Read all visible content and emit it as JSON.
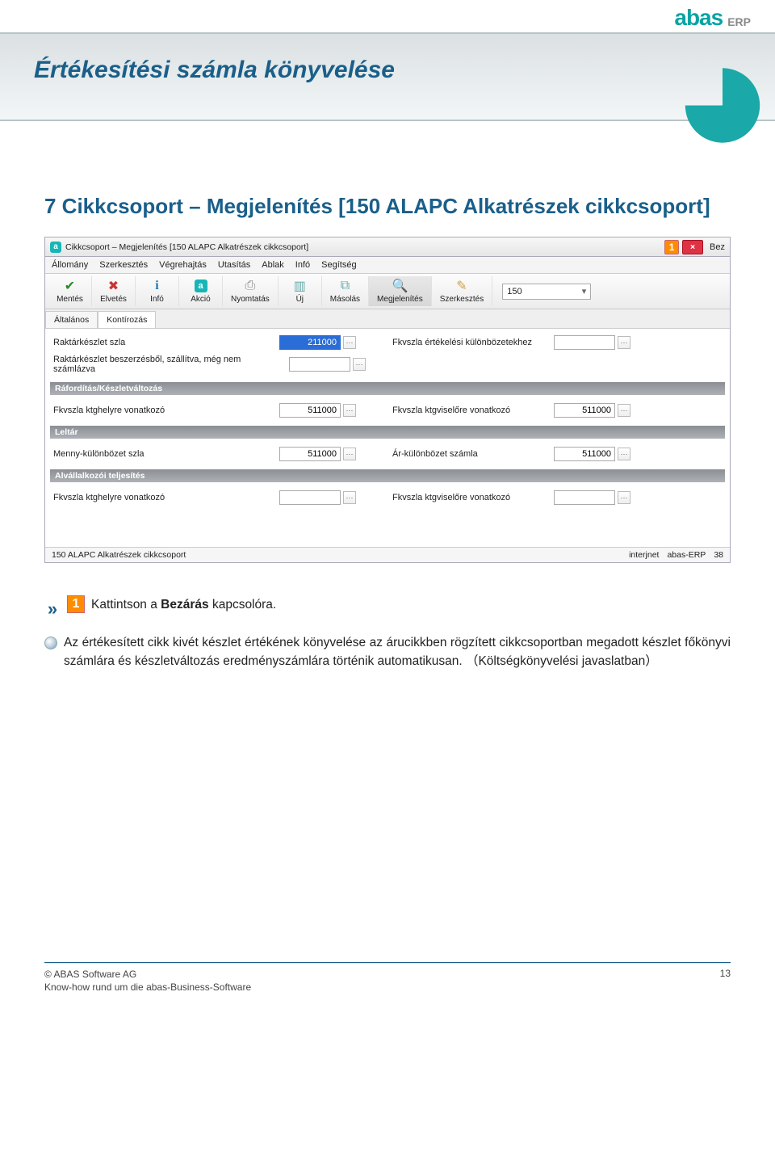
{
  "brand": {
    "logo": "abas",
    "sub": "ERP"
  },
  "header": {
    "title": "Értékesítési számla könyvelése"
  },
  "section": {
    "heading": "7 Cikkcsoport – Megjelenítés [150   ALAPC   Alkatrészek cikkcsoport]"
  },
  "window": {
    "title": "Cikkcsoport – Megjelenítés [150   ALAPC   Alkatrészek cikkcsoport]",
    "pin": "1",
    "close": "×",
    "bez_label": "Bez",
    "menu": [
      "Állomány",
      "Szerkesztés",
      "Végrehajtás",
      "Utasítás",
      "Ablak",
      "Infó",
      "Segítség"
    ],
    "toolbar": [
      {
        "name": "mentes",
        "icon": "✔",
        "label": "Mentés",
        "color": "#2a8a2a"
      },
      {
        "name": "elvetes",
        "icon": "✖",
        "label": "Elvetés",
        "color": "#c33"
      },
      {
        "name": "info",
        "icon": "i",
        "label": "Infó",
        "color": "#27a"
      },
      {
        "name": "akcio",
        "icon": "a",
        "label": "Akció",
        "color": "#16b6b6"
      },
      {
        "name": "nyomtatas",
        "icon": "⎙",
        "label": "Nyomtatás",
        "color": "#888"
      },
      {
        "name": "uj",
        "icon": "▥",
        "label": "Új",
        "color": "#6aa"
      },
      {
        "name": "masolas",
        "icon": "⧉",
        "label": "Másolás",
        "color": "#6aa"
      },
      {
        "name": "megjelenites",
        "icon": "🔍",
        "label": "Megjelenítés",
        "color": "#777"
      },
      {
        "name": "szerkesztes",
        "icon": "✎",
        "label": "Szerkesztés",
        "color": "#cca24a"
      }
    ],
    "search_value": "150",
    "tabs": [
      "Általános",
      "Kontírozás"
    ],
    "active_tab": 1,
    "fields": {
      "raktarkeszlet_szla": {
        "label": "Raktárkészlet szla",
        "value": "211000",
        "highlighted": true
      },
      "raktar_beszerzes": {
        "label": "Raktárkészlet beszerzésből, szállítva, még nem számlázva",
        "value": ""
      },
      "fkv_ertek_kulonb": {
        "label": "Fkvszla értékelési különbözetekhez",
        "value": ""
      },
      "sec1": "Ráfordítás/Készletváltozás",
      "fkv_ktghely": {
        "label": "Fkvszla ktghelyre vonatkozó",
        "value": "511000"
      },
      "fkv_ktgviselo": {
        "label": "Fkvszla ktgviselőre vonatkozó",
        "value": "511000"
      },
      "sec2": "Leltár",
      "menny_kulonb": {
        "label": "Menny-különbözet szla",
        "value": "511000"
      },
      "ar_kulonb": {
        "label": "Ár-különbözet számla",
        "value": "511000"
      },
      "sec3": "Alvállalkozói teljesítés",
      "alv_ktghely": {
        "label": "Fkvszla ktghelyre vonatkozó",
        "value": ""
      },
      "alv_ktgviselo": {
        "label": "Fkvszla ktgviselőre vonatkozó",
        "value": ""
      }
    },
    "status_left": "150 ALAPC     Alkatrészek cikkcsoport",
    "status_right": [
      "interjnet",
      "abas-ERP",
      "38"
    ]
  },
  "instructions": {
    "line1_pre": "Kattintson  a ",
    "line1_bold": "Bezárás",
    "line1_post": "  kapcsolóra.",
    "line2": "Az értékesített cikk kivét készlet értékének könyvelése az árucikkben rögzített cikkcsoportban megadott készlet főkönyvi számlára és készletváltozás eredményszámlára történik automatikusan. （Költségkönyvelési  javaslatban）"
  },
  "footer": {
    "copyright": "© ABAS Software AG",
    "tagline": "Know-how  rund  um  die  abas-Business-Software",
    "page": "13"
  }
}
